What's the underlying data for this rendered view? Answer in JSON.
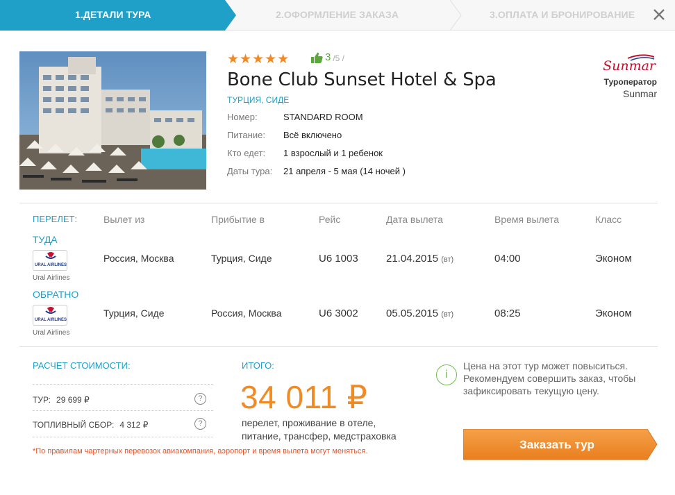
{
  "steps": [
    {
      "label": "1.ДЕТАЛИ ТУРА",
      "active": true
    },
    {
      "label": "2.ОФОРМЛЕНИЕ ЗАКАЗА",
      "active": false
    },
    {
      "label": "3.ОПЛАТА И БРОНИРОВАНИЕ",
      "active": false
    }
  ],
  "colors": {
    "accent": "#1fa0c9",
    "orange": "#f08a24",
    "green": "#5aa83c",
    "red_note": "#e2542a"
  },
  "hotel": {
    "stars": "★★★★★",
    "star_count": 5,
    "rating_value": "3",
    "rating_max": "/5 /",
    "name": "Bone Club Sunset Hotel & Spa",
    "location": "Турция, Сиде",
    "details": [
      {
        "label": "Номер:",
        "value": "STANDARD ROOM"
      },
      {
        "label": "Питание:",
        "value": "Всё включено"
      },
      {
        "label": "Кто едет:",
        "value": "1 взрослый и 1 ребенок"
      },
      {
        "label": "Даты тура:",
        "value": "21 апреля - 5 мая (14 ночей )"
      }
    ]
  },
  "operator": {
    "logo_text": "Sunmar",
    "label": "Туроператор",
    "name": "Sunmar"
  },
  "flights": {
    "section_label": "Перелет:",
    "columns": [
      "Вылет из",
      "Прибытие в",
      "Рейс",
      "Дата вылета",
      "Время вылета",
      "Класс"
    ],
    "legs": [
      {
        "direction": "Туда",
        "airline": "Ural Airlines",
        "logo_text": "URAL AIRLINES",
        "from": "Россия, Москва",
        "to": "Турция, Сиде",
        "flight": "U6 1003",
        "date": "21.04.2015",
        "dow": "(вт)",
        "time": "04:00",
        "class": "Эконом"
      },
      {
        "direction": "Обратно",
        "airline": "Ural Airlines",
        "logo_text": "URAL AIRLINES",
        "from": "Турция, Сиде",
        "to": "Россия, Москва",
        "flight": "U6 3002",
        "date": "05.05.2015",
        "dow": "(вт)",
        "time": "08:25",
        "class": "Эконом"
      }
    ]
  },
  "cost": {
    "title": "Расчет стоимости:",
    "rows": [
      {
        "label": "Тур:",
        "value": "29 699 ₽"
      },
      {
        "label": "Топливный сбор:",
        "value": "4 312 ₽"
      }
    ],
    "help_icon": "?",
    "note": "*По правилам чартерных перевозок авиакомпания, аэропорт и время вылета могут меняться."
  },
  "total": {
    "title": "Итого:",
    "amount": "34 011 ₽",
    "description": "перелет, проживание в отеле, питание, трансфер, медстраховка"
  },
  "warning": {
    "icon": "i",
    "text": "Цена на этот тур может повыситься. Рекомендуем совершить заказ, чтобы зафиксировать текущую цену."
  },
  "order_button": {
    "label": "Заказать тур"
  }
}
